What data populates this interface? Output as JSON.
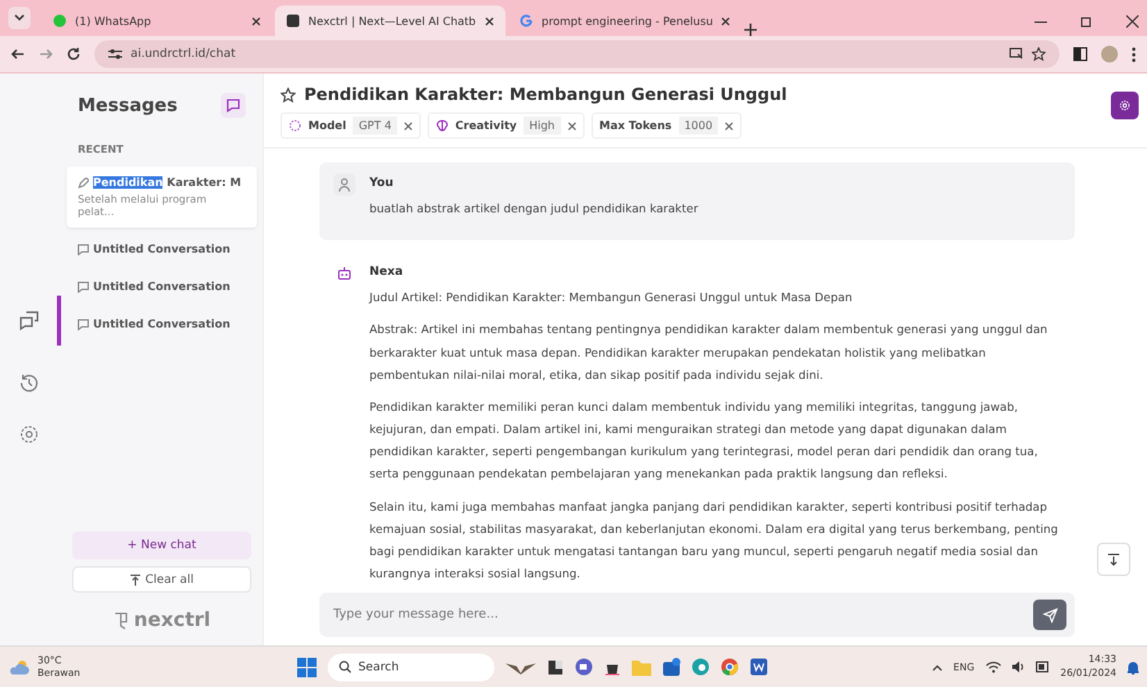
{
  "browser": {
    "tabs": [
      {
        "title": "(1) WhatsApp",
        "kind": "whatsapp",
        "selected": false
      },
      {
        "title": "Nexctrl | Next—Level AI Chatb",
        "kind": "app",
        "selected": true
      },
      {
        "title": "prompt engineering - Penelusu",
        "kind": "google",
        "selected": false
      }
    ],
    "url": "ai.undrctrl.id/chat"
  },
  "sidebar": {
    "title": "Messages",
    "section": "RECENT",
    "conversations": [
      {
        "title": [
          {
            "text": "Pendidikan",
            "highlighted": true
          },
          {
            "text": " Karakter: M",
            "highlighted": false
          }
        ],
        "preview": "Setelah melalui program pelat...",
        "kind": "edit",
        "selected": true
      },
      {
        "title": [
          {
            "text": "Untitled Conversation",
            "highlighted": false
          }
        ],
        "kind": "chat",
        "selected": false
      },
      {
        "title": [
          {
            "text": "Untitled Conversation",
            "highlighted": false
          }
        ],
        "kind": "chat",
        "selected": false
      },
      {
        "title": [
          {
            "text": "Untitled Conversation",
            "highlighted": false
          }
        ],
        "kind": "chat",
        "selected": false
      }
    ],
    "new_chat": "+ New chat",
    "clear_all": "Clear all",
    "logo": "nexctrl"
  },
  "rail": [
    {
      "kind": "chat",
      "selected": true
    },
    {
      "kind": "history",
      "selected": false
    },
    {
      "kind": "settings",
      "selected": false
    }
  ],
  "chat": {
    "title": "Pendidikan Karakter: Membangun Generasi Unggul",
    "chips": [
      {
        "label": "Model",
        "value": "GPT 4",
        "kind": "model"
      },
      {
        "label": "Creativity",
        "value": "High",
        "kind": "creativity"
      },
      {
        "label": "Max Tokens",
        "value": "1000",
        "kind": "plain"
      }
    ],
    "messages": [
      {
        "author": "You",
        "kind": "user",
        "paragraphs": [
          "buatlah abstrak artikel dengan judul pendidikan karakter"
        ]
      },
      {
        "author": "Nexa",
        "kind": "bot",
        "paragraphs": [
          "Judul Artikel: Pendidikan Karakter: Membangun Generasi Unggul untuk Masa Depan",
          "Abstrak: Artikel ini membahas tentang pentingnya pendidikan karakter dalam membentuk generasi yang unggul dan berkarakter kuat untuk masa depan. Pendidikan karakter merupakan pendekatan holistik yang melibatkan pembentukan nilai-nilai moral, etika, dan sikap positif pada individu sejak dini.",
          "Pendidikan karakter memiliki peran kunci dalam membentuk individu yang memiliki integritas, tanggung jawab, kejujuran, dan empati. Dalam artikel ini, kami menguraikan strategi dan metode yang dapat digunakan dalam pendidikan karakter, seperti pengembangan kurikulum yang terintegrasi, model peran dari pendidik dan orang tua, serta penggunaan pendekatan pembelajaran yang menekankan pada praktik langsung dan refleksi.",
          "Selain itu, kami juga membahas manfaat jangka panjang dari pendidikan karakter, seperti kontribusi positif terhadap kemajuan sosial, stabilitas masyarakat, dan keberlanjutan ekonomi. Dalam era digital yang terus berkembang, penting bagi pendidikan karakter untuk mengatasi tantangan baru yang muncul, seperti pengaruh negatif media sosial dan kurangnya interaksi sosial langsung."
        ]
      }
    ],
    "input": {
      "placeholder": "Type your message here..."
    }
  },
  "taskbar": {
    "weather": {
      "temp": "30°C",
      "condition": "Berawan"
    },
    "search": "Search",
    "language": "ENG",
    "time": "14:33",
    "date": "26/01/2024"
  }
}
